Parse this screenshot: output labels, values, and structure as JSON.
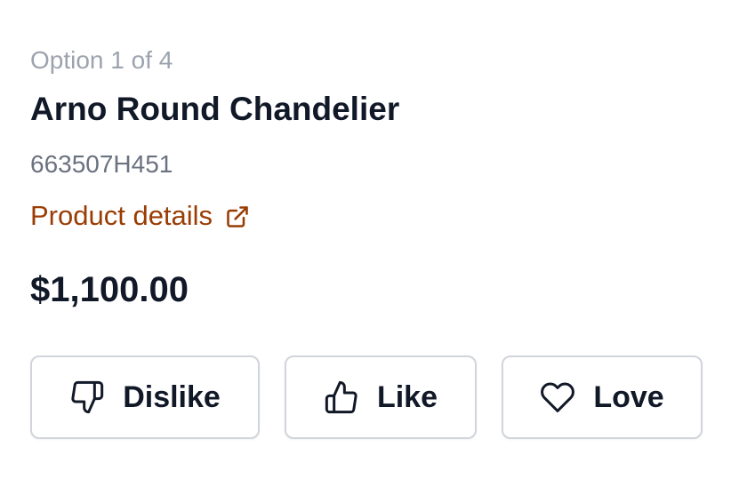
{
  "product": {
    "option_label": "Option 1 of 4",
    "name": "Arno Round Chandelier",
    "sku": "663507H451",
    "details_link_label": "Product details",
    "details_link_icon": "external-link-icon",
    "price": "$1,100.00"
  },
  "actions": {
    "dislike_label": "Dislike",
    "dislike_icon": "thumbs-down-icon",
    "like_label": "Like",
    "like_icon": "thumbs-up-icon",
    "love_label": "Love",
    "love_icon": "heart-icon"
  },
  "colors": {
    "link": "#9a3d05",
    "muted_text": "#9ca3af",
    "primary_text": "#111827",
    "button_border": "#d1d5db"
  }
}
